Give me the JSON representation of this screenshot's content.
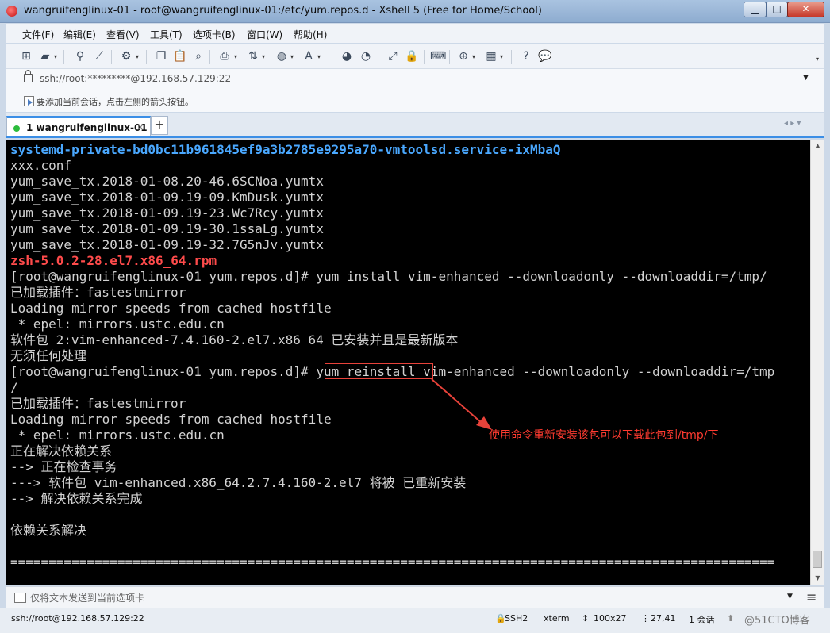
{
  "window": {
    "title": "wangruifenglinux-01 - root@wangruifenglinux-01:/etc/yum.repos.d - Xshell 5 (Free for Home/School)",
    "min_label": "▁",
    "max_label": "□",
    "close_label": "✕"
  },
  "menu": {
    "items": [
      "文件(F)",
      "编辑(E)",
      "查看(V)",
      "工具(T)",
      "选项卡(B)",
      "窗口(W)",
      "帮助(H)"
    ]
  },
  "address": {
    "text": "ssh://root:*********@192.168.57.129:22"
  },
  "hint": {
    "text": "要添加当前会话，点击左侧的箭头按钮。"
  },
  "tab": {
    "number": "1",
    "label": " wangruifenglinux-01",
    "close": "×",
    "add": "+",
    "nav": "◂ ▸  ▾"
  },
  "terminal": {
    "lines": [
      "systemd-private-bd0bc11b961845ef9a3b2785e9295a70-vmtoolsd.service-ixMbaQ",
      "xxx.conf",
      "yum_save_tx.2018-01-08.20-46.6SCNoa.yumtx",
      "yum_save_tx.2018-01-09.19-09.KmDusk.yumtx",
      "yum_save_tx.2018-01-09.19-23.Wc7Rcy.yumtx",
      "yum_save_tx.2018-01-09.19-30.1ssaLg.yumtx",
      "yum_save_tx.2018-01-09.19-32.7G5nJv.yumtx",
      "zsh-5.0.2-28.el7.x86_64.rpm",
      "[root@wangruifenglinux-01 yum.repos.d]# yum install vim-enhanced --downloadonly --downloaddir=/tmp/",
      "已加载插件：fastestmirror",
      "Loading mirror speeds from cached hostfile",
      " * epel: mirrors.ustc.edu.cn",
      "软件包 2:vim-enhanced-7.4.160-2.el7.x86_64 已安装并且是最新版本",
      "无须任何处理",
      "[root@wangruifenglinux-01 yum.repos.d]# yum reinstall vim-enhanced --downloadonly --downloaddir=/tmp",
      "/",
      "已加载插件：fastestmirror",
      "Loading mirror speeds from cached hostfile",
      " * epel: mirrors.ustc.edu.cn",
      "正在解决依赖关系",
      "--> 正在检查事务",
      "---> 软件包 vim-enhanced.x86_64.2.7.4.160-2.el7 将被 已重新安装",
      "--> 解决依赖关系完成",
      "",
      "依赖关系解决",
      "",
      "===================================================================================================="
    ],
    "highlight_text": "yum reinstall",
    "annotation": "使用命令重新安装该包可以下载此包到/tmp/下",
    "colors": {
      "blue": "#4aa8ff",
      "red": "#ff4b4b",
      "annotation": "#ff3b30"
    }
  },
  "compose": {
    "placeholder": "仅将文本发送到当前选项卡"
  },
  "status": {
    "connection": "ssh://root@192.168.57.129:22",
    "protocol": "SSH2",
    "terminal_type": "xterm",
    "size": "100x27",
    "cursor": "27,41",
    "sessions": "1 会话",
    "watermark": "@51CTO博客"
  },
  "icons": {
    "app": "xshell-logo-icon",
    "lock": "lock-icon",
    "hint": "arrow-hint-icon"
  }
}
